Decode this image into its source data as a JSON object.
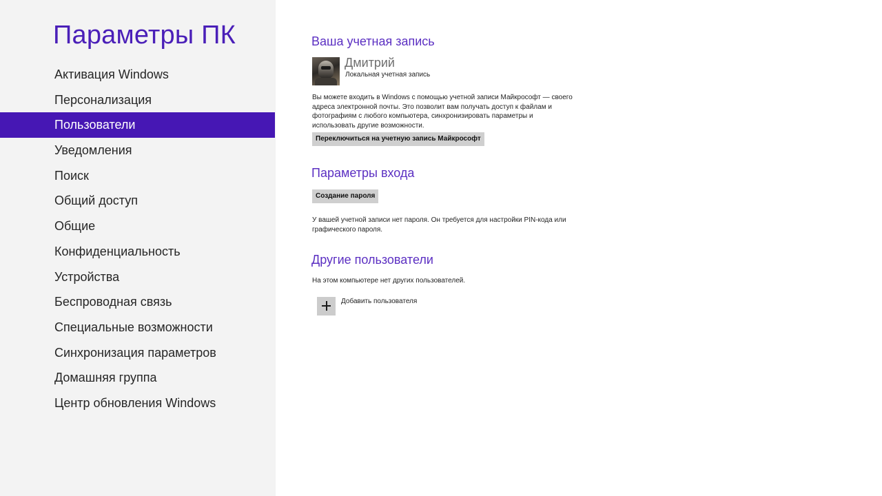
{
  "sidebar": {
    "title": "Параметры ПК",
    "active_color": "#4617b4",
    "items": [
      {
        "label": "Активация Windows"
      },
      {
        "label": "Персонализация"
      },
      {
        "label": "Пользователи",
        "active": true
      },
      {
        "label": "Уведомления"
      },
      {
        "label": "Поиск"
      },
      {
        "label": "Общий доступ"
      },
      {
        "label": "Общие"
      },
      {
        "label": "Конфиденциальность"
      },
      {
        "label": "Устройства"
      },
      {
        "label": "Беспроводная связь"
      },
      {
        "label": "Специальные возможности"
      },
      {
        "label": "Синхронизация параметров"
      },
      {
        "label": "Домашняя группа"
      },
      {
        "label": "Центр обновления Windows"
      }
    ]
  },
  "account": {
    "title": "Ваша учетная запись",
    "user_name": "Дмитрий",
    "account_type": "Локальная учетная запись",
    "avatar_icon": "avatar-picture",
    "description": "Вы можете входить в Windows с помощью учетной записи Майкрософт — своего адреса электронной почты. Это позволит вам получать доступ к файлам и фотографиям с любого компьютера, синхронизировать параметры и использовать другие возможности.",
    "switch_button": "Переключиться на учетную запись Майкрософт"
  },
  "signin": {
    "title": "Параметры входа",
    "create_password_button": "Создание пароля",
    "note": "У вашей учетной записи нет пароля. Он требуется для настройки PIN-кода или графического пароля."
  },
  "other_users": {
    "title": "Другие пользователи",
    "note": "На этом компьютере нет других пользователей.",
    "add_user_label": "Добавить пользователя",
    "add_icon": "plus-icon"
  },
  "colors": {
    "accent": "#4617b4",
    "heading": "#5b2fc2",
    "sidebar_bg": "#f3f3f3",
    "button_bg": "#cfcfcf"
  }
}
